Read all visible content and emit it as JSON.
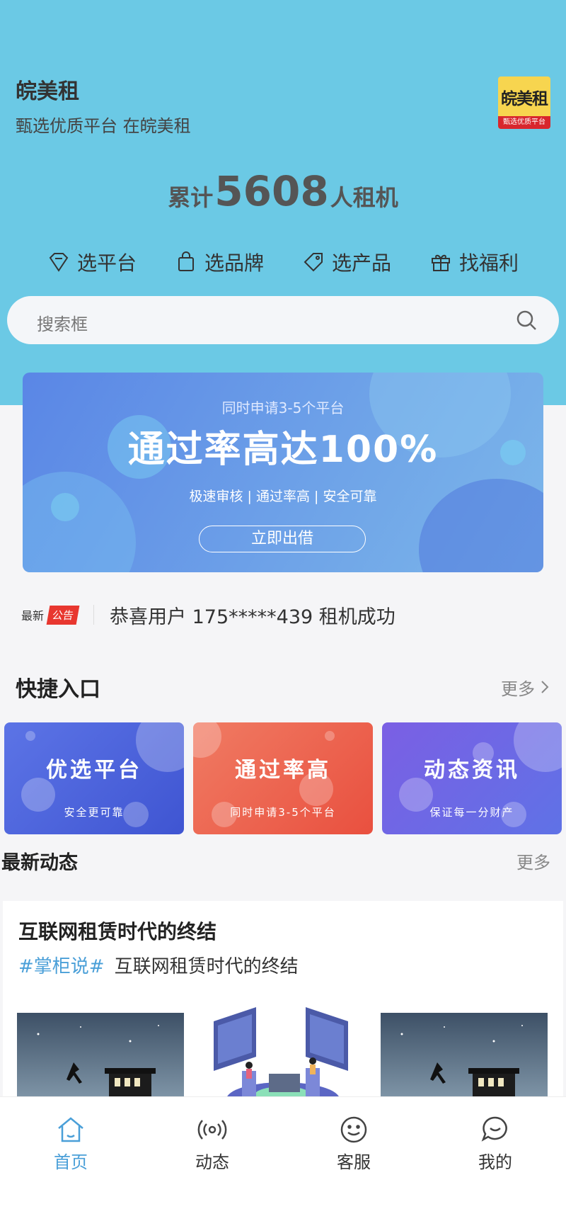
{
  "header": {
    "app_name": "皖美租",
    "slogan": "甄选优质平台 在皖美租",
    "logo_main": "皖美租",
    "logo_strip": "甄选优质平台"
  },
  "counter": {
    "prefix": "累计",
    "value": "5608",
    "suffix": "人租机"
  },
  "categories": [
    {
      "label": "选平台",
      "icon": "diamond-icon"
    },
    {
      "label": "选品牌",
      "icon": "bag-icon"
    },
    {
      "label": "选产品",
      "icon": "tag-icon"
    },
    {
      "label": "找福利",
      "icon": "gift-icon"
    }
  ],
  "search": {
    "placeholder": "搜索框"
  },
  "banner": {
    "subtitle": "同时申请3-5个平台",
    "title": "通过率高达100%",
    "tags": "极速审核 | 通过率高 | 安全可靠",
    "button": "立即出借"
  },
  "notice": {
    "new_label": "最新",
    "tag": "公告",
    "text": "恭喜用户 175*****439 租机成功"
  },
  "quick_entry": {
    "title": "快捷入口",
    "more": "更多",
    "cards": [
      {
        "title": "优选平台",
        "subtitle": "安全更可靠",
        "color": "#4b63db"
      },
      {
        "title": "通过率高",
        "subtitle": "同时申请3-5个平台",
        "color": "#ec6a55"
      },
      {
        "title": "动态资讯",
        "subtitle": "保证每一分财产",
        "color": "#6a63e2"
      }
    ]
  },
  "latest": {
    "title": "最新动态",
    "more": "更多",
    "article": {
      "title": "互联网租赁时代的终结",
      "hashtag": "#掌柜说#",
      "summary": "互联网租赁时代的终结"
    }
  },
  "tabbar": [
    {
      "label": "首页",
      "icon": "home-icon",
      "active": true
    },
    {
      "label": "动态",
      "icon": "broadcast-icon",
      "active": false
    },
    {
      "label": "客服",
      "icon": "smiley-icon",
      "active": false
    },
    {
      "label": "我的",
      "icon": "chat-bubble-icon",
      "active": false
    }
  ],
  "colors": {
    "header_bg": "#6bc9e5",
    "accent": "#4a9fd8",
    "notice_tag": "#e8372f"
  }
}
